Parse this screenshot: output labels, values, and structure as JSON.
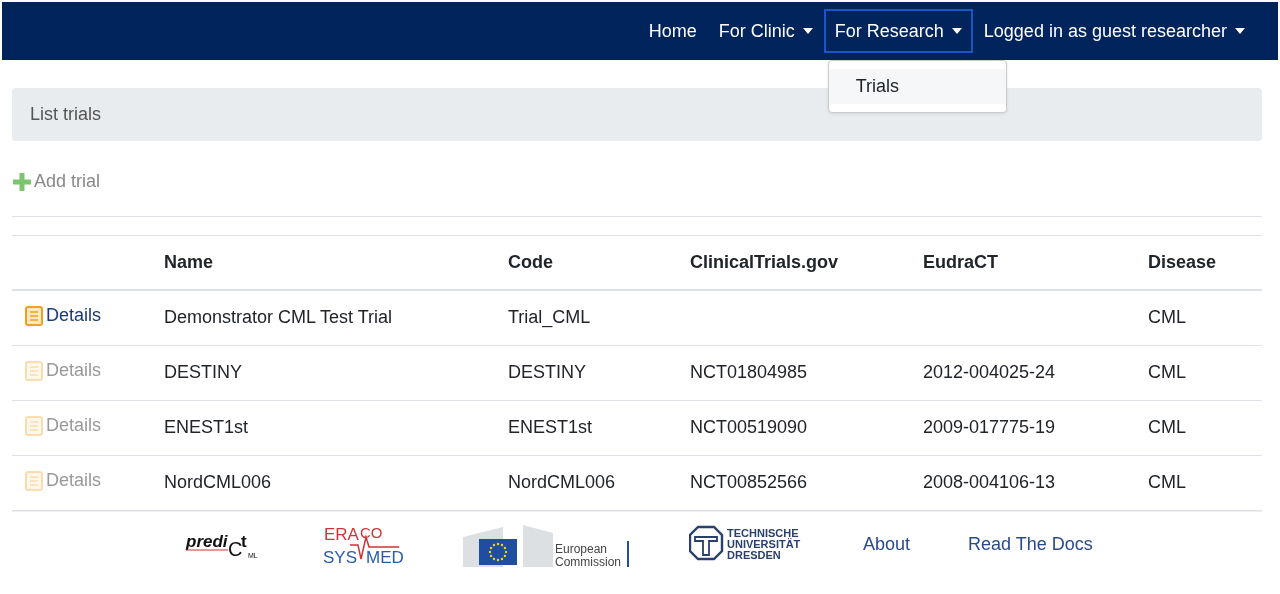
{
  "navbar": {
    "items": [
      {
        "label": "Home",
        "kind": "link",
        "open": false
      },
      {
        "label": "For Clinic",
        "kind": "dropdown",
        "open": false
      },
      {
        "label": "For Research",
        "kind": "dropdown",
        "open": true,
        "menu": [
          "Trials"
        ]
      },
      {
        "label": "Logged in as guest researcher",
        "kind": "dropdown",
        "open": false
      }
    ]
  },
  "breadcrumb": "List trials",
  "add_button": "Add trial",
  "table": {
    "columns": [
      "Name",
      "Code",
      "ClinicalTrials.gov",
      "EudraCT",
      "Disease"
    ],
    "rows": [
      {
        "link": "Details",
        "disabled": false,
        "cells": [
          "Demonstrator CML Test Trial",
          "Trial_CML",
          "",
          "",
          "CML"
        ]
      },
      {
        "link": "Details",
        "disabled": true,
        "cells": [
          "DESTINY",
          "DESTINY",
          "NCT01804985",
          "2012-004025-24",
          "CML"
        ]
      },
      {
        "link": "Details",
        "disabled": true,
        "cells": [
          "ENEST1st",
          "ENEST1st",
          "NCT00519090",
          "2009-017775-19",
          "CML"
        ]
      },
      {
        "link": "Details",
        "disabled": true,
        "cells": [
          "NordCML006",
          "NordCML006",
          "NCT00852566",
          "2008-004106-13",
          "CML"
        ]
      }
    ]
  },
  "footer": {
    "predict_logo": {
      "main": "predi",
      "c": "C",
      "t": "t",
      "sub": "ML"
    },
    "eracosysmed_logo": {
      "top_left": "ERA",
      "top_right": "CO",
      "bottom_left": "SYS",
      "bottom_right": "MED"
    },
    "ec_logo": [
      "European",
      "Commission"
    ],
    "tud_logo": [
      "TECHNISCHE",
      "UNIVERSITÄT",
      "DRESDEN"
    ],
    "links": [
      "About",
      "Read The Docs"
    ]
  }
}
